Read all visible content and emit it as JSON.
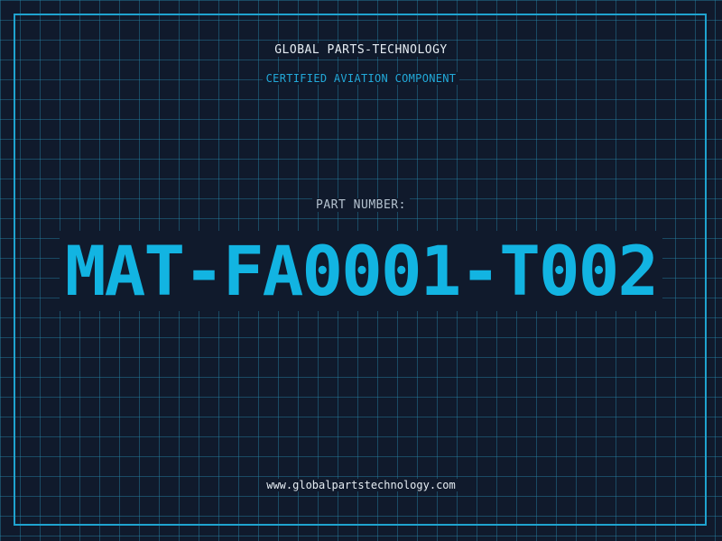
{
  "header": {
    "company": "GLOBAL PARTS-TECHNOLOGY",
    "subtitle": "CERTIFIED AVIATION COMPONENT"
  },
  "part": {
    "label": "PART NUMBER:",
    "number": "MAT-FA0001-T002"
  },
  "footer": {
    "website": "www.globalpartstechnology.com"
  },
  "colors": {
    "background": "#101a2c",
    "grid": "#288caf",
    "frame": "#1fa3cf",
    "accent": "#12b4e2",
    "text": "#e6edf3"
  }
}
